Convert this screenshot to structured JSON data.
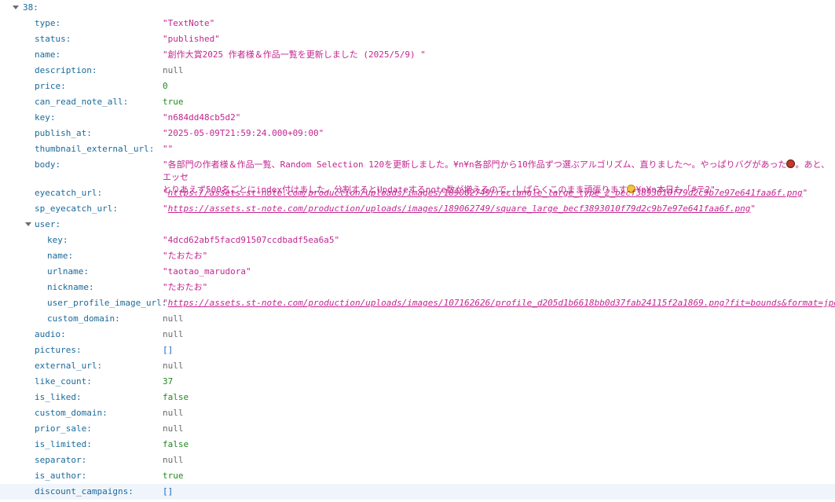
{
  "root": {
    "index_label": "38:"
  },
  "fields": [
    {
      "key": "type:",
      "value": "\"TextNote\"",
      "kind": "str"
    },
    {
      "key": "status:",
      "value": "\"published\"",
      "kind": "str"
    },
    {
      "key": "name:",
      "value": "\"創作大賞2025 作者様＆作品一覧を更新しました (2025/5/9) \"",
      "kind": "str"
    },
    {
      "key": "description:",
      "value": "null",
      "kind": "null"
    },
    {
      "key": "price:",
      "value": "0",
      "kind": "num"
    },
    {
      "key": "can_read_note_all:",
      "value": "true",
      "kind": "bool"
    },
    {
      "key": "key:",
      "value": "\"n684dd48cb5d2\"",
      "kind": "str"
    },
    {
      "key": "publish_at:",
      "value": "\"2025-05-09T21:59:24.000+09:00\"",
      "kind": "str"
    },
    {
      "key": "thumbnail_external_url:",
      "value": "\"\"",
      "kind": "str"
    }
  ],
  "body_field": {
    "key": "body:",
    "line1_a": "\"各部門の作者様＆作品一覧、Random Selection 120を更新しました。¥n¥n各部門から10作品ずつ選ぶアルゴリズム、直りました〜。やっぱりバグがあった",
    "line1_b": "。あと、エッセ",
    "line2_a": "とりあえず500名ごとにindex付けました。分割するとUpdateするnote数が増えるので、しばらくこのまま頑張ります",
    "line2_b": "¥n¥n本日も「#テ2\""
  },
  "eyecatch_url": {
    "key": "eyecatch_url:",
    "quote": "\"",
    "url": "https://assets.st-note.com/production/uploads/images/189062749/rectangle_large_type_2_becf3893010f79d2c9b7e97e641faa6f.png"
  },
  "sp_eyecatch_url": {
    "key": "sp_eyecatch_url:",
    "quote": "\"",
    "url": "https://assets.st-note.com/production/uploads/images/189062749/square_large_becf3893010f79d2c9b7e97e641faa6f.png"
  },
  "user": {
    "key": "user:",
    "fields": [
      {
        "key": "key:",
        "value": "\"4dcd62abf5facd91507ccdbadf5ea6a5\"",
        "kind": "str"
      },
      {
        "key": "name:",
        "value": "\"たおたお\"",
        "kind": "str"
      },
      {
        "key": "urlname:",
        "value": "\"taotao_marudora\"",
        "kind": "str"
      },
      {
        "key": "nickname:",
        "value": "\"たおたお\"",
        "kind": "str"
      }
    ],
    "profile_image": {
      "key": "user_profile_image_url:",
      "quote": "\"",
      "url": "https://assets.st-note.com/production/uploads/images/107162626/profile_d205d1b6618bb0d37fab24115f2a1869.png?fit=bounds&format=jpeg&quality=85&width=330"
    },
    "custom_domain": {
      "key": "custom_domain:",
      "value": "null",
      "kind": "null"
    }
  },
  "tail_fields": [
    {
      "key": "audio:",
      "value": "null",
      "kind": "null"
    },
    {
      "key": "pictures:",
      "value": "[]",
      "kind": "arr"
    },
    {
      "key": "external_url:",
      "value": "null",
      "kind": "null"
    },
    {
      "key": "like_count:",
      "value": "37",
      "kind": "num"
    },
    {
      "key": "is_liked:",
      "value": "false",
      "kind": "bool"
    },
    {
      "key": "custom_domain:",
      "value": "null",
      "kind": "null"
    },
    {
      "key": "prior_sale:",
      "value": "null",
      "kind": "null"
    },
    {
      "key": "is_limited:",
      "value": "false",
      "kind": "bool"
    },
    {
      "key": "separator:",
      "value": "null",
      "kind": "null"
    },
    {
      "key": "is_author:",
      "value": "true",
      "kind": "bool"
    },
    {
      "key": "discount_campaigns:",
      "value": "[]",
      "kind": "arr"
    }
  ],
  "emoji_names": [
    "ladybug-emoji",
    "sweat-face-emoji"
  ]
}
